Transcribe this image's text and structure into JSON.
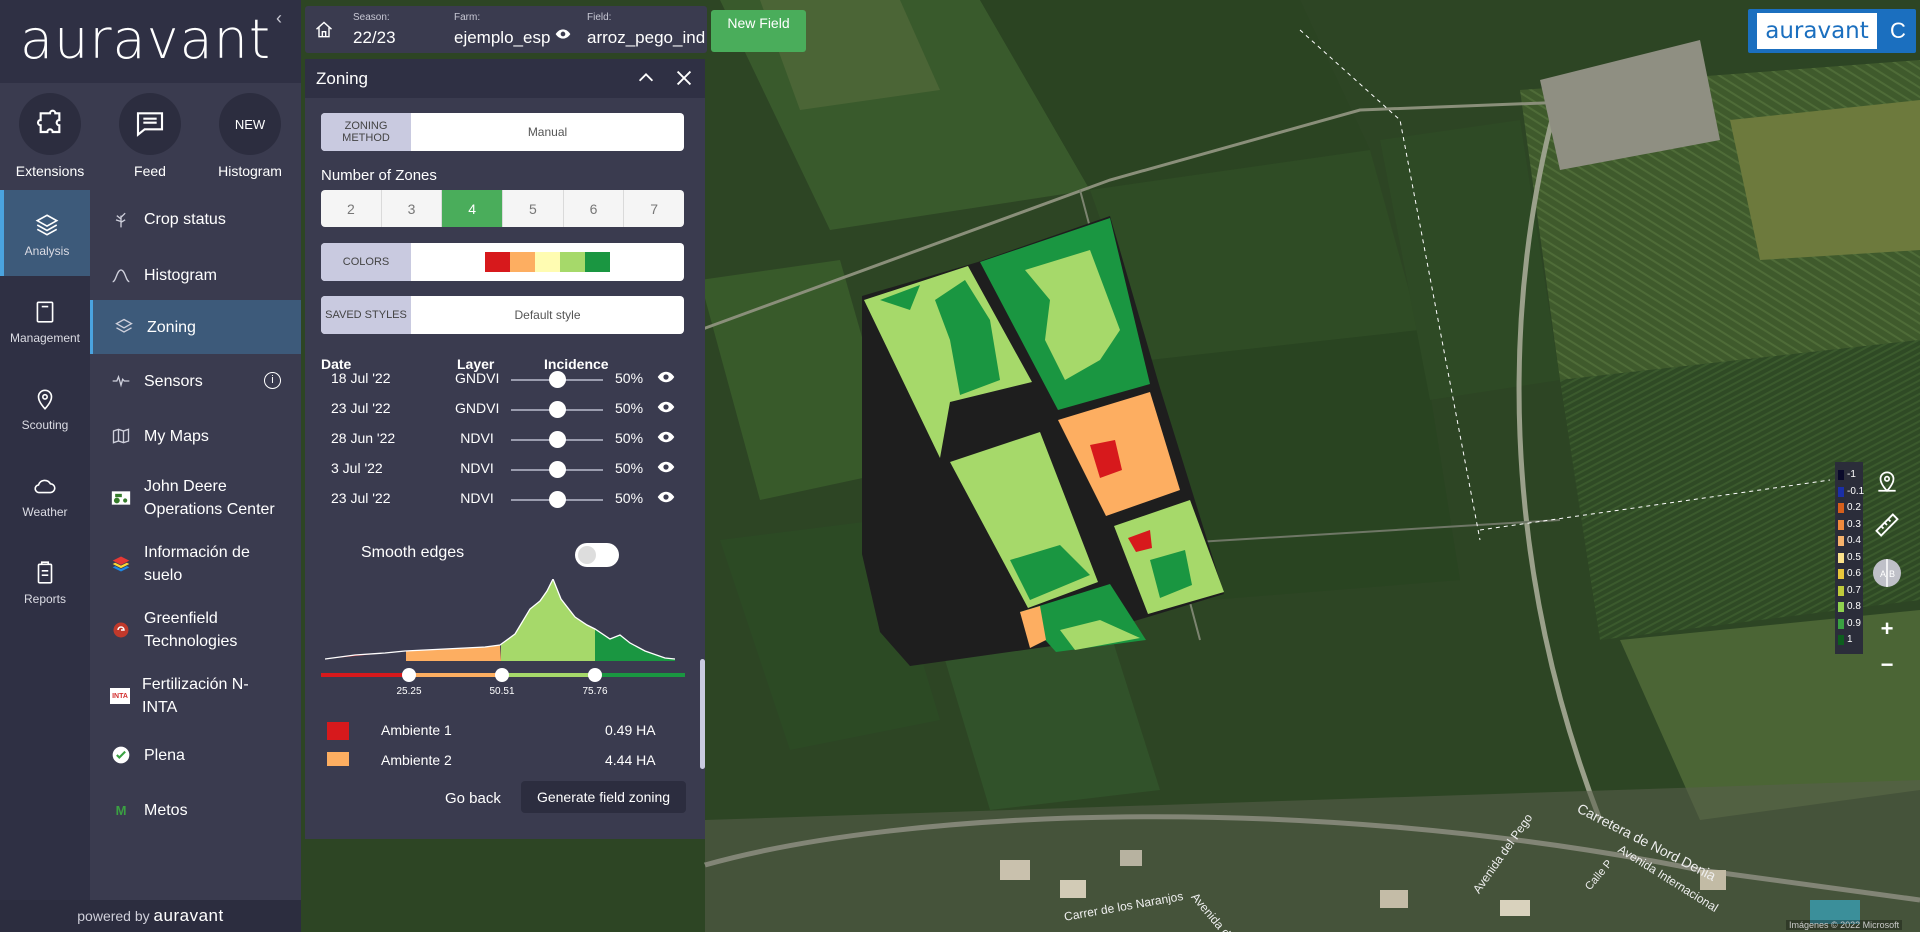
{
  "brand": {
    "logo": "auravant",
    "powered_prefix": "powered by",
    "powered_brand": "auravant",
    "badge_logo": "auravant",
    "badge_user": "C"
  },
  "quick_actions": [
    {
      "label": "Extensions",
      "icon": "puzzle-icon"
    },
    {
      "label": "Feed",
      "icon": "chat-icon"
    },
    {
      "label": "Histogram",
      "icon_text": "NEW"
    }
  ],
  "categories": [
    {
      "label": "Analysis",
      "icon": "layers-icon",
      "active": true
    },
    {
      "label": "Management",
      "icon": "notebook-icon"
    },
    {
      "label": "Scouting",
      "icon": "pin-icon"
    },
    {
      "label": "Weather",
      "icon": "cloud-icon"
    },
    {
      "label": "Reports",
      "icon": "report-icon"
    }
  ],
  "nav": [
    {
      "label": "Crop status",
      "icon": "crop-icon"
    },
    {
      "label": "Histogram",
      "icon": "histogram-icon"
    },
    {
      "label": "Zoning",
      "icon": "layers-icon",
      "active": true
    },
    {
      "label": "Sensors",
      "icon": "pulse-icon",
      "info": "i"
    },
    {
      "label": "My Maps",
      "icon": "map-icon"
    },
    {
      "label": "John Deere Operations Center",
      "icon": "tractor-icon"
    },
    {
      "label": "Información de suelo",
      "icon": "soil-icon"
    },
    {
      "label": "Greenfield Technologies",
      "icon": "greenfield-icon"
    },
    {
      "label": "Fertilización N-INTA",
      "icon_text": "INTA"
    },
    {
      "label": "Plena",
      "icon": "check-icon"
    },
    {
      "label": "Metos",
      "icon_text": "M"
    }
  ],
  "topbar": {
    "season_caption": "Season:",
    "season": "22/23",
    "farm_caption": "Farm:",
    "farm": "ejemplo_esp",
    "field_caption": "Field:",
    "field": "arroz_pego_ind",
    "new_field": "New Field"
  },
  "panel": {
    "title": "Zoning",
    "method_tag": "ZONING METHOD",
    "method": "Manual",
    "zones_label": "Number of Zones",
    "zones": [
      "2",
      "3",
      "4",
      "5",
      "6",
      "7"
    ],
    "selected_zone": "4",
    "colors_tag": "COLORS",
    "colors": [
      "#d7191c",
      "#fdae61",
      "#fffcb2",
      "#a6d96a",
      "#1a9641"
    ],
    "styles_tag": "SAVED STYLES",
    "style": "Default style",
    "headers": {
      "date": "Date",
      "layer": "Layer",
      "incidence": "Incidence"
    },
    "layers": [
      {
        "date": "18 Jul '22",
        "layer": "GNDVI",
        "incidence": "50%",
        "value": 0.5
      },
      {
        "date": "23 Jul '22",
        "layer": "GNDVI",
        "incidence": "50%",
        "value": 0.5
      },
      {
        "date": "28 Jun '22",
        "layer": "NDVI",
        "incidence": "50%",
        "value": 0.5
      },
      {
        "date": "3 Jul '22",
        "layer": "NDVI",
        "incidence": "50%",
        "value": 0.5
      },
      {
        "date": "23 Jul '22",
        "layer": "NDVI",
        "incidence": "50%",
        "value": 0.5
      }
    ],
    "smooth_label": "Smooth edges",
    "smooth_on": false,
    "thresholds": [
      "25.25",
      "50.51",
      "75.76"
    ],
    "zone_list": [
      {
        "name": "Ambiente 1",
        "area": "0.49 HA",
        "color": "#d7191c"
      },
      {
        "name": "Ambiente 2",
        "area": "4.44 HA",
        "color": "#fdae61"
      }
    ],
    "go_back": "Go back",
    "generate": "Generate field zoning"
  },
  "legend": [
    {
      "label": "-1",
      "color": "#0a0a2a"
    },
    {
      "label": "-0.1",
      "color": "#1b2fa8"
    },
    {
      "label": "0.2",
      "color": "#d7601c"
    },
    {
      "label": "0.3",
      "color": "#f08a3c"
    },
    {
      "label": "0.4",
      "color": "#f7b26b"
    },
    {
      "label": "0.5",
      "color": "#fbe28c"
    },
    {
      "label": "0.6",
      "color": "#e8c53a"
    },
    {
      "label": "0.7",
      "color": "#bfc93a"
    },
    {
      "label": "0.8",
      "color": "#8fd14f"
    },
    {
      "label": "0.9",
      "color": "#3aa142"
    },
    {
      "label": "1",
      "color": "#0d5e1e"
    }
  ],
  "map_labels": {
    "road1": "Carretera de Nord Denia",
    "road2": "Avenida Internacional",
    "road3": "Carrer de los Naranjos",
    "road4": "Avenida del Pego",
    "road5": "Avenida del Pego",
    "road6": "Calle P",
    "copyright": "Imágenes © 2022 Microsoft"
  }
}
